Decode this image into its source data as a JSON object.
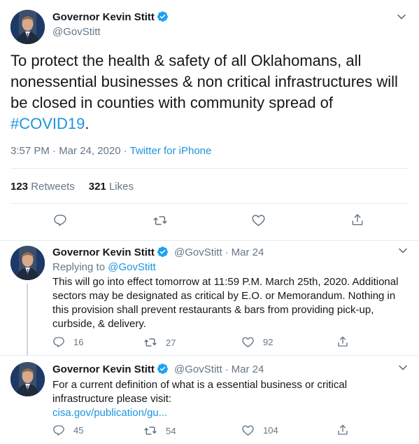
{
  "main_tweet": {
    "name": "Governor Kevin Stitt",
    "handle": "@GovStitt",
    "text_before": "To protect the health & safety of all Oklahomans, all nonessential businesses & non critical infrastructures will be closed in counties with community spread of ",
    "hashtag": "#COVID19",
    "text_after": ".",
    "time": "3:57 PM · Mar 24, 2020 · ",
    "source": "Twitter for iPhone",
    "retweets_count": "123",
    "retweets_label": "Retweets",
    "likes_count": "321",
    "likes_label": "Likes"
  },
  "replies": [
    {
      "name": "Governor Kevin Stitt",
      "handle": "@GovStitt",
      "date": "Mar 24",
      "replying_label": "Replying to ",
      "replying_to": "@GovStitt",
      "text": "This will go into effect tomorrow at 11:59 P.M. March 25th, 2020. Additional sectors may be designated as critical by E.O. or Memorandum. Nothing in this provision shall prevent restaurants & bars from providing pick-up, curbside, & delivery.",
      "reply_count": "16",
      "retweet_count": "27",
      "like_count": "92"
    },
    {
      "name": "Governor Kevin Stitt",
      "handle": "@GovStitt",
      "date": "Mar 24",
      "text": "For a current definition of what is a essential business or critical infrastructure please visit:",
      "link": "cisa.gov/publication/gu...",
      "reply_count": "45",
      "retweet_count": "54",
      "like_count": "104"
    }
  ],
  "icons": {
    "verified": "verified-badge-icon",
    "caret": "chevron-down-icon",
    "reply": "reply-icon",
    "retweet": "retweet-icon",
    "like": "heart-icon",
    "share": "share-icon"
  },
  "colors": {
    "link": "#1b95e0",
    "secondary_text": "#657786",
    "border": "#e6ecf0",
    "verified": "#1da1f2"
  }
}
